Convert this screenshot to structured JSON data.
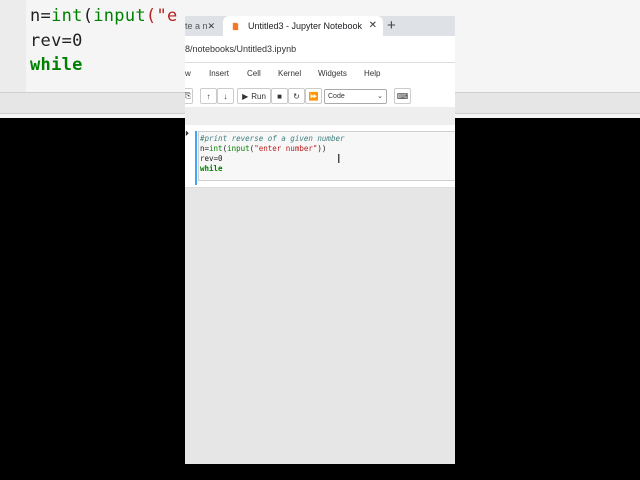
{
  "background_editor": {
    "line1_var": "n=",
    "line1_fn": "int",
    "line1_paren": "(",
    "line1_fn2": "input",
    "line1_rest": "(\"e",
    "line2": "rev=0",
    "line3": "while"
  },
  "browser": {
    "tabs": [
      {
        "label": "te a n",
        "close": "✕"
      },
      {
        "label": "Untitled3 - Jupyter Notebook",
        "close": "✕"
      }
    ],
    "new_tab": "+",
    "url": "8/notebooks/Untitled3.ipynb"
  },
  "menu": {
    "items": [
      "w",
      "Insert",
      "Cell",
      "Kernel",
      "Widgets",
      "Help"
    ]
  },
  "toolbar": {
    "run_label": "Run",
    "cell_type": "Code"
  },
  "cell": {
    "comment": "#print reverse of a given number",
    "line2_var": "n=",
    "line2_fn1": "int",
    "line2_p1": "(",
    "line2_fn2": "input",
    "line2_p2": "(",
    "line2_str": "\"enter number\"",
    "line2_end": "))",
    "line3": "rev=0",
    "line4": "while"
  },
  "colors": {
    "keyword": "#008000",
    "string": "#ba2121",
    "comment": "#408080",
    "cell_border": "#42a5f5"
  }
}
